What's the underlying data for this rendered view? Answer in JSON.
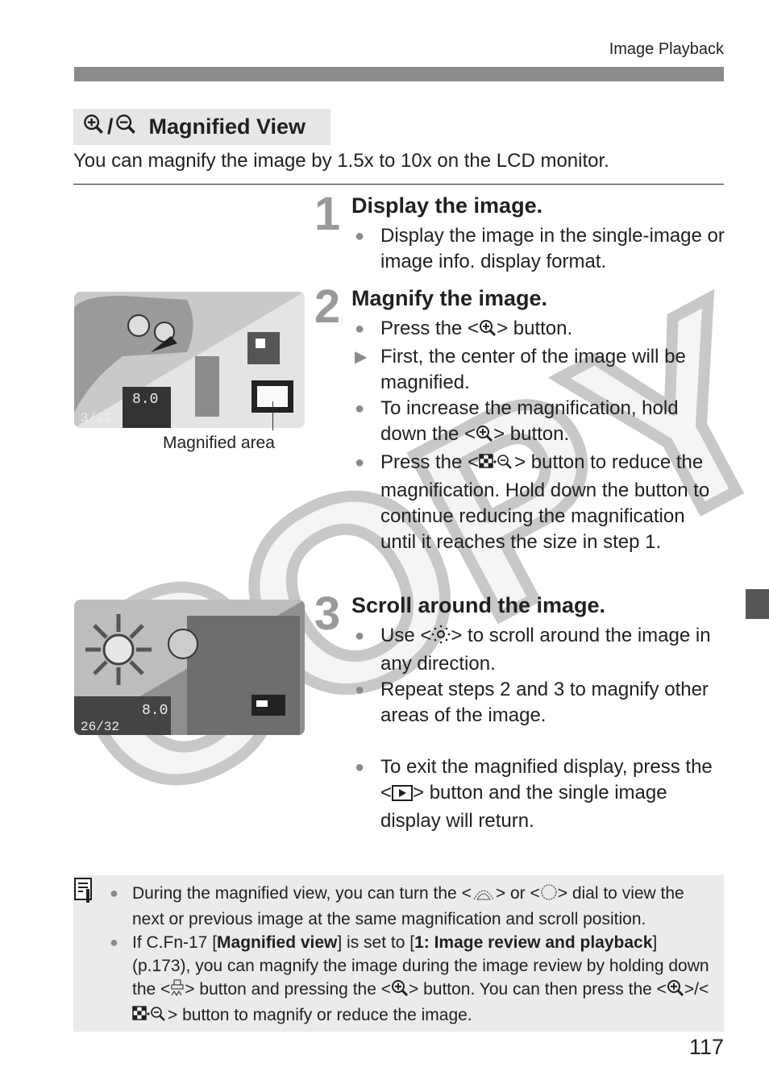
{
  "running_head": "Image Playback",
  "section": {
    "title": "Magnified View",
    "title_icons": [
      "zoom-in-icon",
      "zoom-out-icon"
    ],
    "title_separator": "/",
    "intro": "You can magnify the image by 1.5x to 10x on the LCD monitor."
  },
  "steps": [
    {
      "number": "1",
      "heading": "Display the image.",
      "bullets": [
        {
          "marker": "bullet",
          "parts": [
            {
              "t": "Display the image in the single-image or image info. display format."
            }
          ]
        }
      ]
    },
    {
      "number": "2",
      "heading": "Magnify the image.",
      "bullets": [
        {
          "marker": "bullet",
          "parts": [
            {
              "t": "Press the <"
            },
            {
              "icon": "zoom-in"
            },
            {
              "t": "> button."
            }
          ]
        },
        {
          "marker": "arrow",
          "parts": [
            {
              "t": "First, the center of the image will be magnified."
            }
          ]
        },
        {
          "marker": "bullet",
          "parts": [
            {
              "t": "To increase the magnification, hold down the <"
            },
            {
              "icon": "zoom-in"
            },
            {
              "t": "> button."
            }
          ]
        },
        {
          "marker": "bullet",
          "parts": [
            {
              "t": "Press the <"
            },
            {
              "icon": "index-zoom-out"
            },
            {
              "t": "> button to reduce the magnification. Hold down the button to continue reducing the magnification until it reaches the size in step 1."
            }
          ]
        }
      ]
    },
    {
      "number": "3",
      "heading": "Scroll around the image.",
      "bullets": [
        {
          "marker": "bullet",
          "parts": [
            {
              "t": "Use <"
            },
            {
              "icon": "multi-controller"
            },
            {
              "t": "> to scroll around the image in any direction."
            }
          ]
        },
        {
          "marker": "bullet",
          "parts": [
            {
              "t": "Repeat steps 2 and 3 to magnify other areas of the image."
            }
          ]
        },
        {
          "marker": "bullet",
          "gap": true,
          "parts": [
            {
              "t": "To exit the magnified display, press the <"
            },
            {
              "icon": "playback"
            },
            {
              "t": "> button and the single image display will return."
            }
          ]
        }
      ]
    }
  ],
  "photos": [
    {
      "name": "camera-back-magnify-button-photo",
      "lcd_value": "8.0",
      "lcd_count": "3/32",
      "caption": "Magnified area"
    },
    {
      "name": "multi-controller-scroll-photo",
      "lcd_value": "8.0",
      "lcd_count": "26/32"
    }
  ],
  "note": {
    "icon": "memo-icon",
    "bullets": [
      {
        "marker": "bullet",
        "parts": [
          {
            "t": "During the magnified view, you can turn the <"
          },
          {
            "icon": "main-dial"
          },
          {
            "t": "> or <"
          },
          {
            "icon": "quick-control-dial"
          },
          {
            "t": "> dial to view the next or previous image at the same magnification and scroll position."
          }
        ]
      },
      {
        "marker": "bullet",
        "parts": [
          {
            "t": "If C.Fn-17 ["
          },
          {
            "b": "Magnified view"
          },
          {
            "t": "] is set to ["
          },
          {
            "b": "1: Image review and playback"
          },
          {
            "t": "] (p.173), you can magnify the image during the image review by holding down the <"
          },
          {
            "icon": "print-share"
          },
          {
            "t": "> button and pressing the <"
          },
          {
            "icon": "zoom-in"
          },
          {
            "t": "> button. You can then press the <"
          },
          {
            "icon": "zoom-in"
          },
          {
            "t": ">/<"
          },
          {
            "icon": "index-zoom-out"
          },
          {
            "t": "> button to magnify or reduce the image."
          }
        ]
      }
    ]
  },
  "watermark": "COPY",
  "page_number": "117",
  "colors": {
    "title_bg": "#e6e6e6",
    "note_bg": "#ebebeb",
    "bar": "#8a8a8a",
    "step_number": "#9a9a9a",
    "text": "#231f20"
  }
}
